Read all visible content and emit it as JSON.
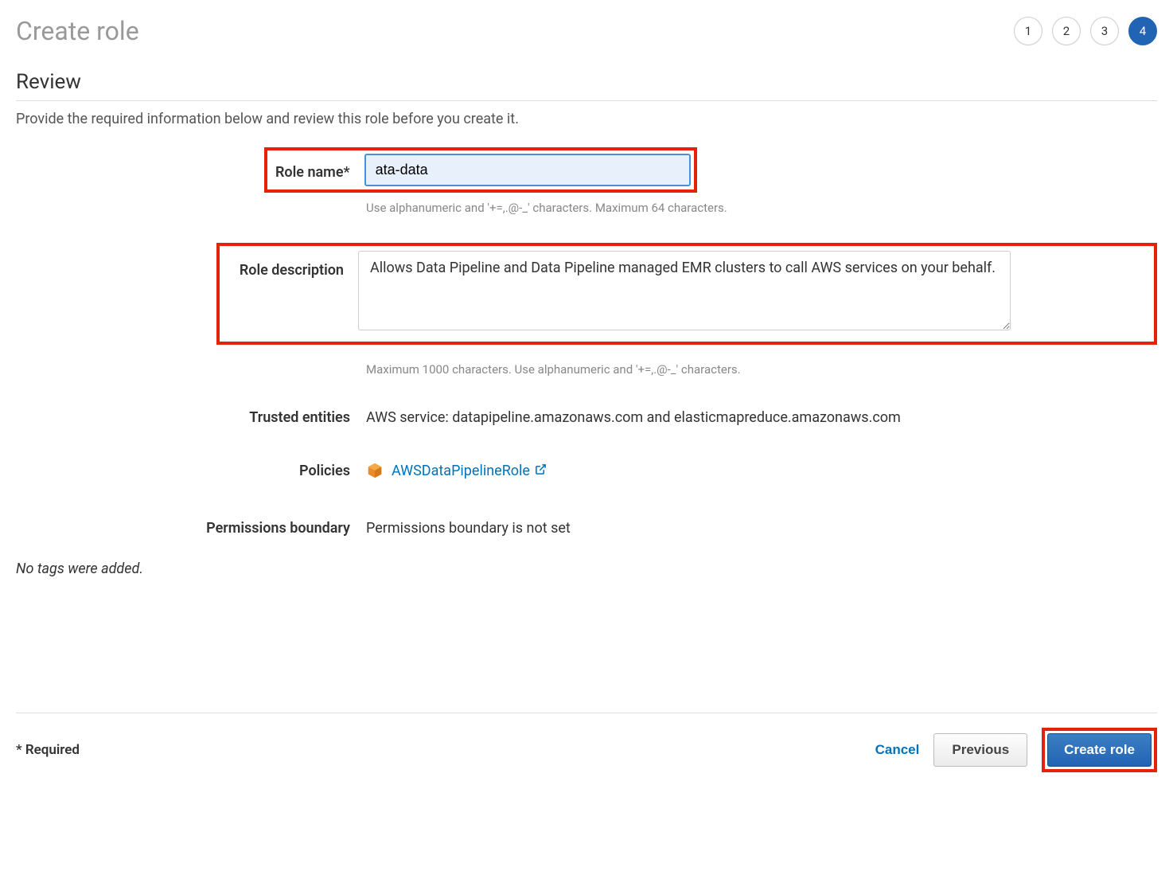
{
  "page": {
    "title": "Create role",
    "steps": [
      "1",
      "2",
      "3",
      "4"
    ],
    "activeStep": 3
  },
  "section": {
    "title": "Review",
    "subtitle": "Provide the required information below and review this role before you create it."
  },
  "form": {
    "roleName": {
      "label": "Role name*",
      "value": "ata-data",
      "hint": "Use alphanumeric and '+=,.@-_' characters. Maximum 64 characters."
    },
    "roleDescription": {
      "label": "Role description",
      "value": "Allows Data Pipeline and Data Pipeline managed EMR clusters to call AWS services on your behalf.",
      "hint": "Maximum 1000 characters. Use alphanumeric and '+=,.@-_' characters."
    },
    "trustedEntities": {
      "label": "Trusted entities",
      "value": "AWS service: datapipeline.amazonaws.com and elasticmapreduce.amazonaws.com"
    },
    "policies": {
      "label": "Policies",
      "link": "AWSDataPipelineRole"
    },
    "permissionsBoundary": {
      "label": "Permissions boundary",
      "value": "Permissions boundary is not set"
    }
  },
  "tags": {
    "note": "No tags were added."
  },
  "footer": {
    "requiredNote": "* Required",
    "cancel": "Cancel",
    "previous": "Previous",
    "create": "Create role"
  }
}
